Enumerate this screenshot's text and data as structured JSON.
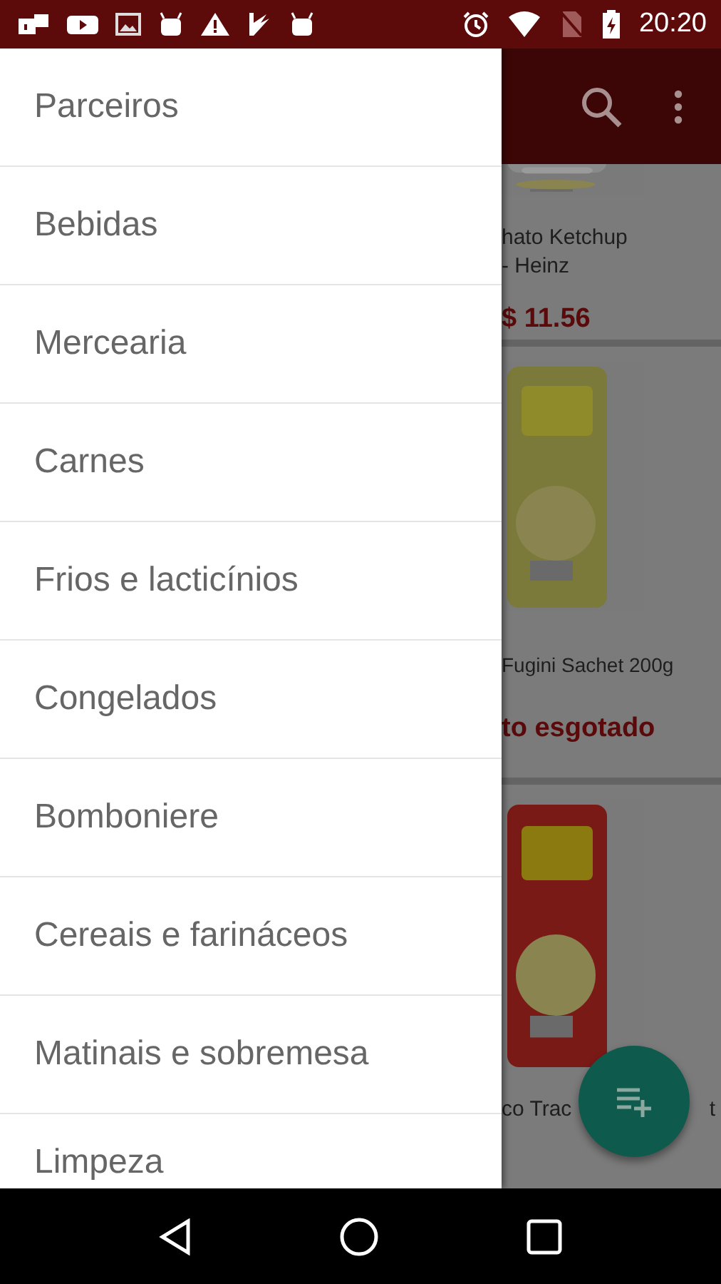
{
  "status_bar": {
    "time": "20:20"
  },
  "drawer": {
    "items": [
      {
        "label": "Parceiros"
      },
      {
        "label": "Bebidas"
      },
      {
        "label": "Mercearia"
      },
      {
        "label": "Carnes"
      },
      {
        "label": "Frios e lacticínios"
      },
      {
        "label": "Congelados"
      },
      {
        "label": "Bomboniere"
      },
      {
        "label": "Cereais e farináceos"
      },
      {
        "label": "Matinais e sobremesa"
      },
      {
        "label": "Limpeza"
      }
    ]
  },
  "products": [
    {
      "name": [
        "hato Ketchup",
        "- Heinz"
      ],
      "price": "$ 11.56"
    },
    {
      "name": [
        "Fugini Sachet 200g"
      ],
      "price": "to esgotado"
    },
    {
      "name": [
        "co Trac",
        "t"
      ]
    }
  ]
}
